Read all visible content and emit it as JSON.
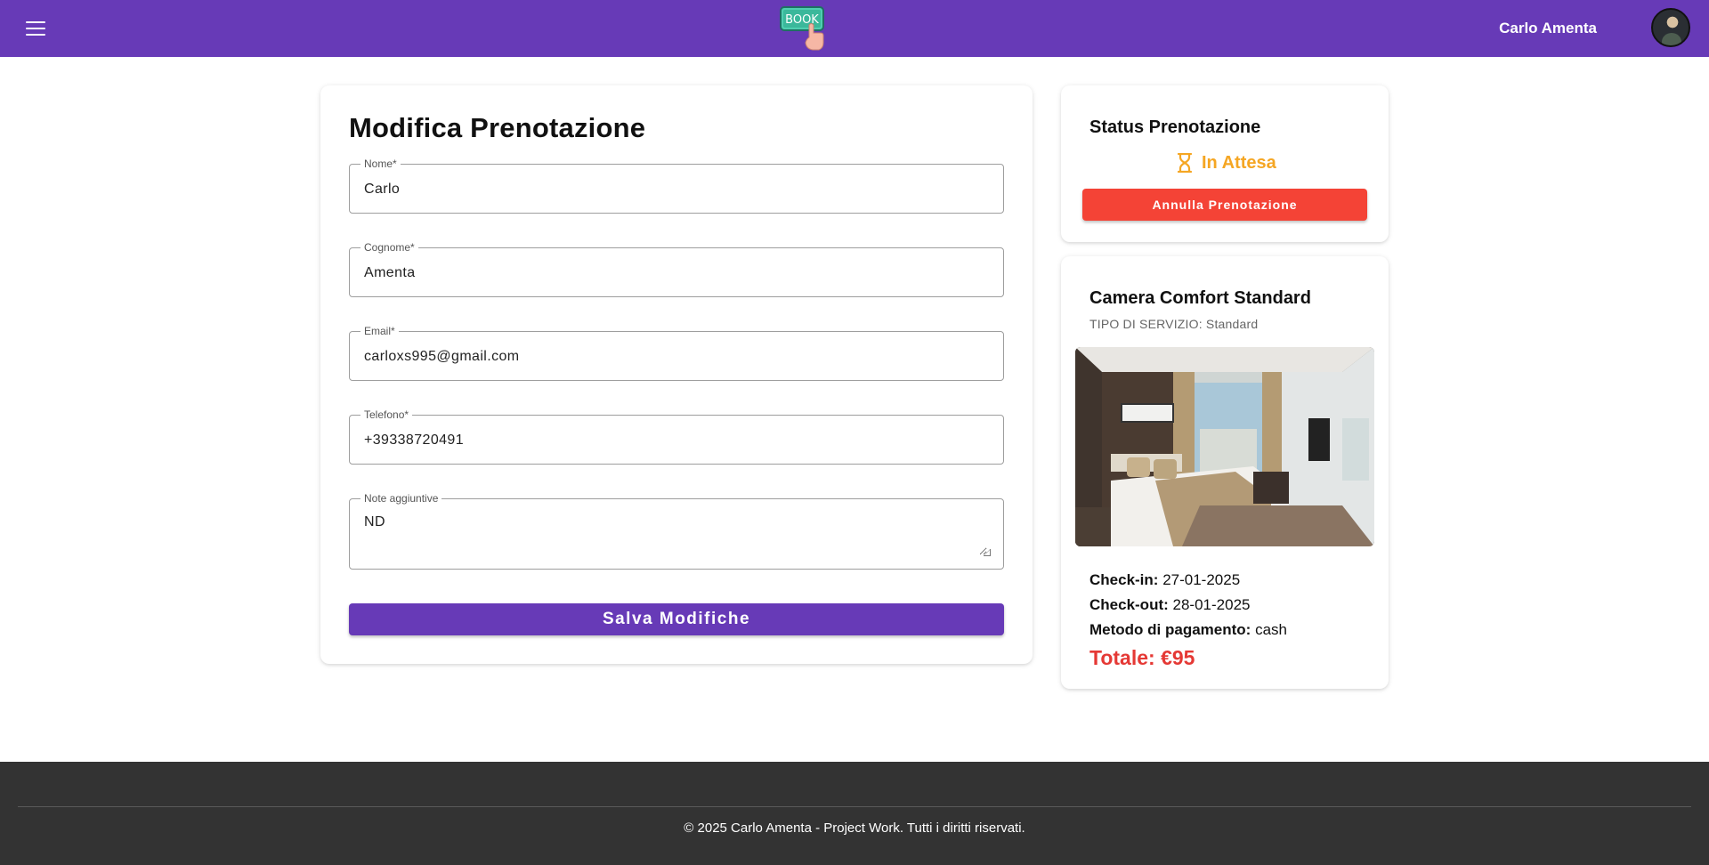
{
  "header": {
    "menu_icon": "hamburger-menu-icon",
    "logo_text": "BOOK",
    "user_name": "Carlo Amenta"
  },
  "form": {
    "title": "Modifica Prenotazione",
    "fields": [
      {
        "label": "Nome*",
        "value": "Carlo"
      },
      {
        "label": "Cognome*",
        "value": "Amenta"
      },
      {
        "label": "Email*",
        "value": "carloxs995@gmail.com"
      },
      {
        "label": "Telefono*",
        "value": "+39338720491"
      },
      {
        "label": "Note aggiuntive",
        "value": "ND"
      }
    ],
    "save_label": "Salva Modifiche"
  },
  "status": {
    "title": "Status Prenotazione",
    "icon": "hourglass-icon",
    "value": "In Attesa",
    "cancel_label": "Annulla Prenotazione"
  },
  "room": {
    "title": "Camera Comfort Standard",
    "service_type": "TIPO DI SERVIZIO: Standard",
    "checkin_label": "Check-in:",
    "checkin_value": "27-01-2025",
    "checkout_label": "Check-out:",
    "checkout_value": "28-01-2025",
    "payment_label": "Metodo di pagamento:",
    "payment_value": "cash",
    "total": "Totale: €95"
  },
  "footer": {
    "text": "© 2025 Carlo Amenta - Project Work. Tutti i diritti riservati."
  },
  "colors": {
    "primary": "#673ab7",
    "danger": "#f44336",
    "pending": "#f5a623",
    "total": "#e53935",
    "footer_bg": "#333333"
  }
}
